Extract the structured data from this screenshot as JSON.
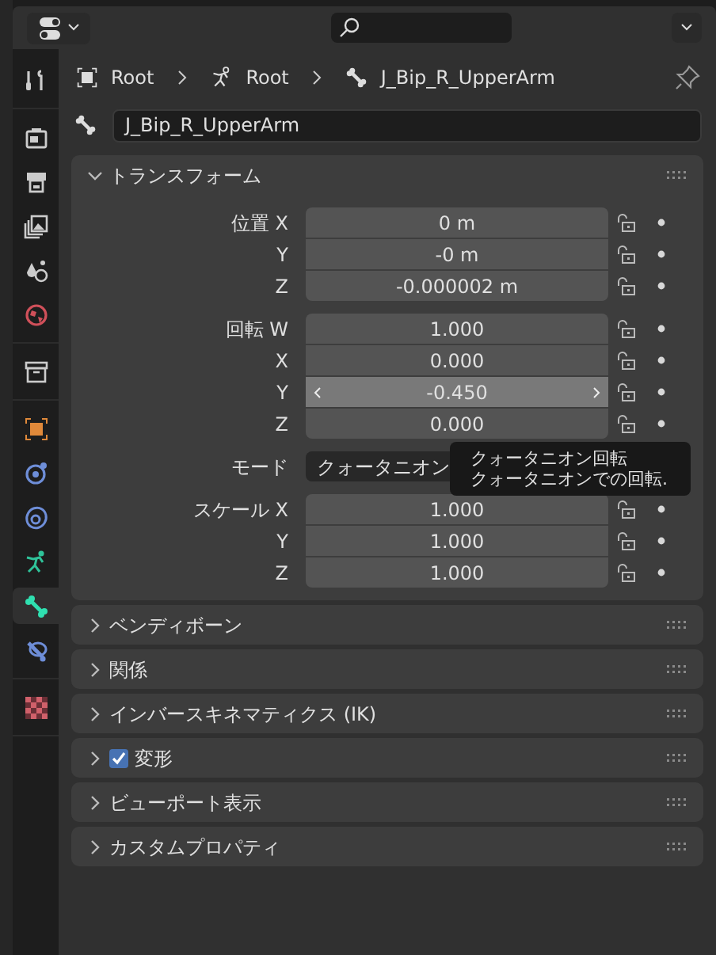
{
  "breadcrumb": [
    {
      "kind": "object",
      "label": "Root"
    },
    {
      "kind": "armature",
      "label": "Root"
    },
    {
      "kind": "bone",
      "label": "J_Bip_R_UpperArm"
    }
  ],
  "bone_name": "J_Bip_R_UpperArm",
  "sidebar": [
    [
      {
        "kind": "tool",
        "selected": false
      }
    ],
    [
      {
        "kind": "render",
        "selected": false
      },
      {
        "kind": "output",
        "selected": false
      },
      {
        "kind": "view-layer",
        "selected": false
      },
      {
        "kind": "scene",
        "selected": false
      },
      {
        "kind": "world",
        "selected": false
      }
    ],
    [
      {
        "kind": "collection",
        "selected": false
      }
    ],
    [
      {
        "kind": "object",
        "selected": false
      },
      {
        "kind": "constraint",
        "selected": false
      },
      {
        "kind": "data",
        "selected": false
      },
      {
        "kind": "armature",
        "selected": false
      },
      {
        "kind": "bone",
        "selected": true
      },
      {
        "kind": "bone-constraint",
        "selected": false
      }
    ],
    [
      {
        "kind": "texture",
        "selected": false
      }
    ]
  ],
  "transform": {
    "title": "トランスフォーム",
    "expanded": true,
    "groups": [
      {
        "kind": "vector",
        "rows": [
          {
            "label": "位置 X",
            "value": "0 m",
            "hovered": false
          },
          {
            "label": "Y",
            "value": "-0 m",
            "hovered": false
          },
          {
            "label": "Z",
            "value": "-0.000002 m",
            "hovered": false
          }
        ]
      },
      {
        "kind": "vector",
        "rows": [
          {
            "label": "回転 W",
            "value": "1.000",
            "hovered": false
          },
          {
            "label": "X",
            "value": "0.000",
            "hovered": false
          },
          {
            "label": "Y",
            "value": "-0.450",
            "hovered": true
          },
          {
            "label": "Z",
            "value": "0.000",
            "hovered": false
          }
        ]
      },
      {
        "kind": "dropdown",
        "rows": [
          {
            "label": "モード",
            "value": "クォータニオン"
          }
        ]
      },
      {
        "kind": "vector",
        "rows": [
          {
            "label": "スケール X",
            "value": "1.000",
            "hovered": false
          },
          {
            "label": "Y",
            "value": "1.000",
            "hovered": false
          },
          {
            "label": "Z",
            "value": "1.000",
            "hovered": false
          }
        ]
      }
    ]
  },
  "panels": [
    {
      "kind": "plain",
      "title": "ベンディボーン",
      "expanded": false
    },
    {
      "kind": "plain",
      "title": "関係",
      "expanded": false
    },
    {
      "kind": "plain",
      "title": "インバースキネマティクス (IK)",
      "expanded": false
    },
    {
      "kind": "checkbox",
      "title": "変形",
      "expanded": false,
      "checked": true
    },
    {
      "kind": "plain",
      "title": "ビューポート表示",
      "expanded": false
    },
    {
      "kind": "plain",
      "title": "カスタムプロパティ",
      "expanded": false
    }
  ],
  "tooltip": {
    "title": "クォータニオン回転",
    "description": "クォータニオンでの回転."
  }
}
